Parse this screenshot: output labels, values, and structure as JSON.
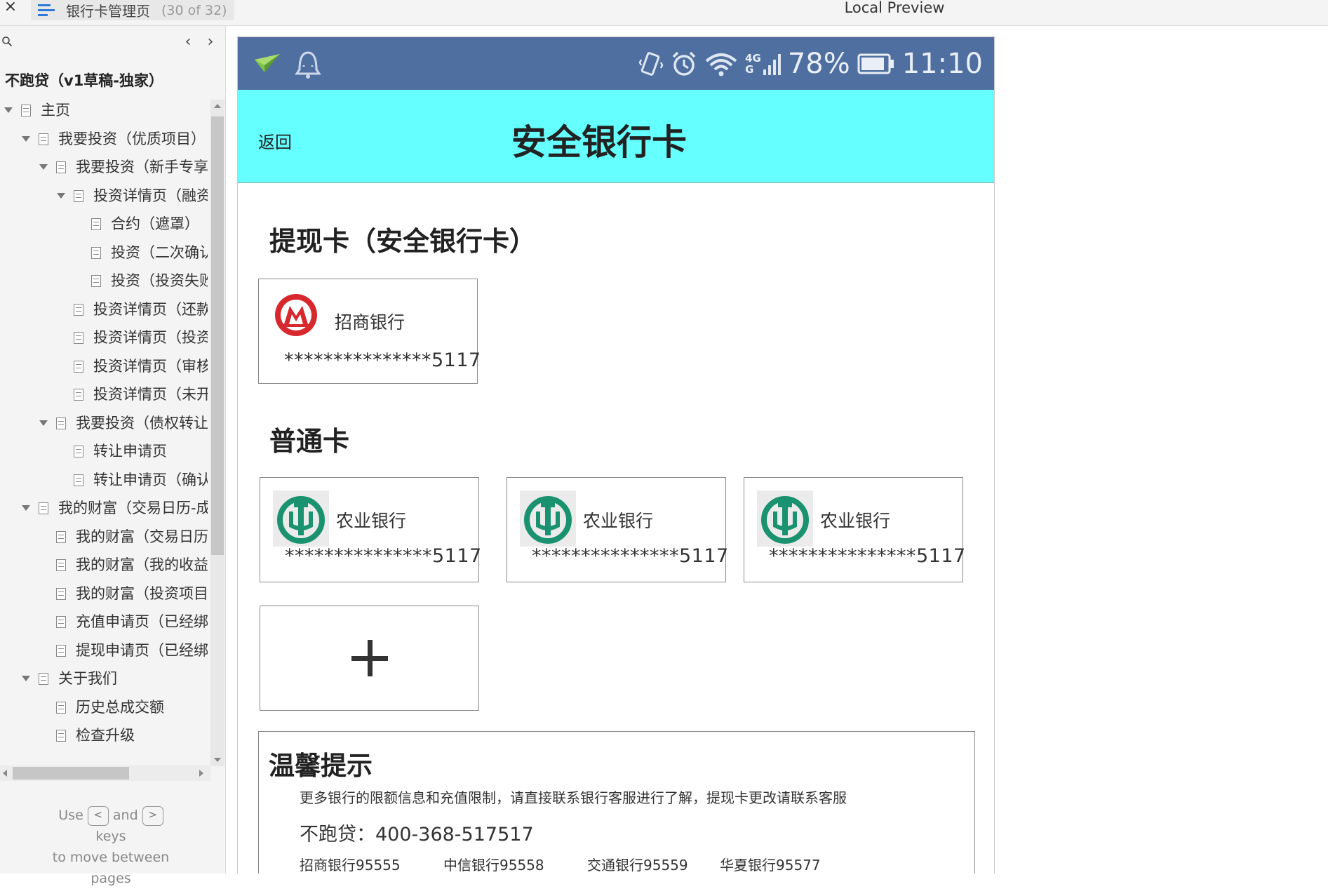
{
  "topbar": {
    "close_label": "×",
    "tab_title": "银行卡管理页",
    "tab_count": "(30 of 32)",
    "preview_title": "Local Preview"
  },
  "sidebar": {
    "project_name": "不跑贷（v1草稿-独家）",
    "prev_label": "‹",
    "next_label": "›",
    "tree": [
      {
        "label": "主页",
        "level": 0,
        "expanded": true
      },
      {
        "label": "我要投资（优质项目）",
        "level": 1,
        "expanded": true
      },
      {
        "label": "我要投资（新手专享",
        "level": 2,
        "expanded": true
      },
      {
        "label": "投资详情页（融资",
        "level": 3,
        "expanded": true
      },
      {
        "label": "合约（遮罩）",
        "level": 4,
        "expanded": null
      },
      {
        "label": "投资（二次确认",
        "level": 4,
        "expanded": null
      },
      {
        "label": "投资（投资失败",
        "level": 4,
        "expanded": null
      },
      {
        "label": "投资详情页（还款",
        "level": 3,
        "expanded": null
      },
      {
        "label": "投资详情页（投资",
        "level": 3,
        "expanded": null
      },
      {
        "label": "投资详情页（审核",
        "level": 3,
        "expanded": null
      },
      {
        "label": "投资详情页（未开",
        "level": 3,
        "expanded": null
      },
      {
        "label": "我要投资（债权转让",
        "level": 2,
        "expanded": true
      },
      {
        "label": "转让申请页",
        "level": 3,
        "expanded": null
      },
      {
        "label": "转让申请页（确认",
        "level": 3,
        "expanded": null
      },
      {
        "label": "我的财富（交易日历-成",
        "level": 1,
        "expanded": true
      },
      {
        "label": "我的财富（交易日历",
        "level": 2,
        "expanded": null
      },
      {
        "label": "我的财富（我的收益",
        "level": 2,
        "expanded": null
      },
      {
        "label": "我的财富（投资项目",
        "level": 2,
        "expanded": null
      },
      {
        "label": "充值申请页（已经绑",
        "level": 2,
        "expanded": null
      },
      {
        "label": "提现申请页（已经绑",
        "level": 2,
        "expanded": null
      },
      {
        "label": "关于我们",
        "level": 1,
        "expanded": true
      },
      {
        "label": "历史总成交额",
        "level": 2,
        "expanded": null
      },
      {
        "label": "检查升级",
        "level": 2,
        "expanded": null
      }
    ],
    "hint": {
      "use": "Use",
      "key_prev": "<",
      "and": "and",
      "key_next": ">",
      "keys": "keys",
      "line3": "to move between",
      "line4": "pages"
    }
  },
  "phone": {
    "status": {
      "net_top": "4G",
      "net_bottom": "G",
      "battery": "78%",
      "time": "11:10"
    },
    "appbar": {
      "back_label": "返回",
      "title": "安全银行卡"
    },
    "withdraw_section_title": "提现卡（安全银行卡）",
    "normal_section_title": "普通卡",
    "withdraw_card": {
      "bank": "招商银行",
      "number": "***************5117"
    },
    "normal_cards": [
      {
        "bank": "农业银行",
        "number": "***************5117"
      },
      {
        "bank": "农业银行",
        "number": "***************5117"
      },
      {
        "bank": "农业银行",
        "number": "***************5117"
      }
    ],
    "tips": {
      "title": "温馨提示",
      "text": "更多银行的限额信息和充值限制，请直接联系银行客服进行了解，提现卡更改请联系客服",
      "phone": "不跑贷：400-368-517517",
      "hotlines": [
        "招商银行95555",
        "中信银行95558",
        "交通银行95559",
        "华夏银行95577"
      ]
    },
    "colors": {
      "statusbar": "#4e6fa0",
      "appbar": "#66ffff",
      "cmb_red": "#d7282e",
      "abc_green": "#1a9270"
    }
  }
}
